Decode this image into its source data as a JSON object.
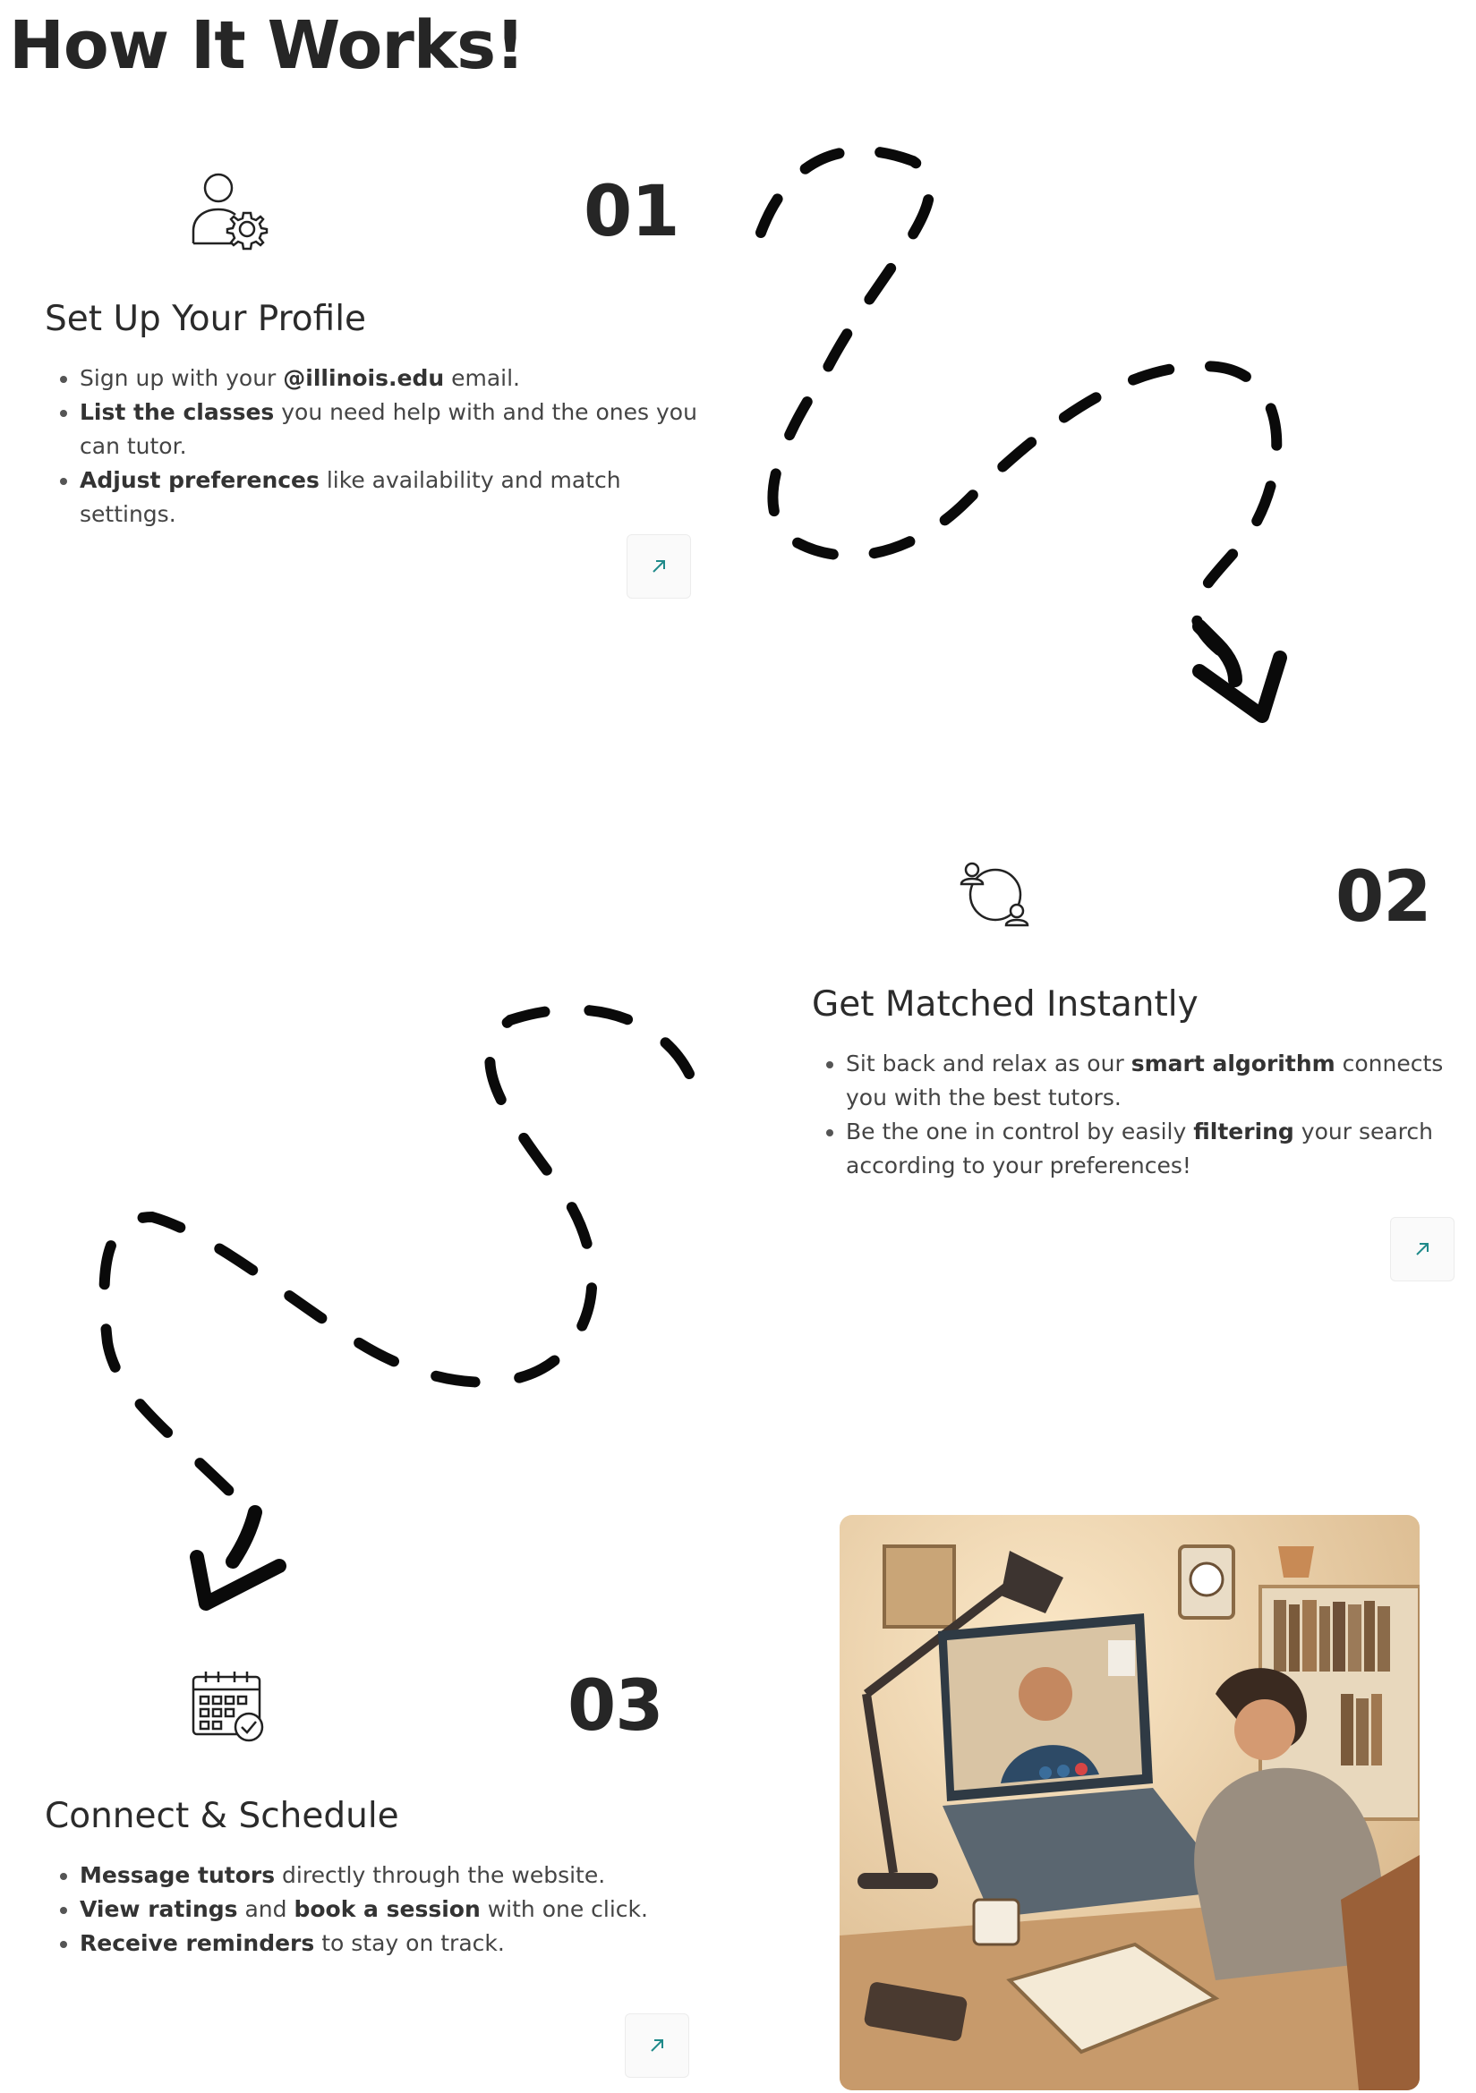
{
  "page_title": "How It Works!",
  "steps": [
    {
      "number": "01",
      "heading": "Set Up Your Profile",
      "icon": "user-gear-icon",
      "bullets": [
        [
          [
            "t",
            "Sign up with your "
          ],
          [
            "b",
            "@illinois.edu"
          ],
          [
            "t",
            " email."
          ]
        ],
        [
          [
            "b",
            "List the classes"
          ],
          [
            "t",
            " you need help with and the ones you can tutor."
          ]
        ],
        [
          [
            "b",
            "Adjust preferences"
          ],
          [
            "t",
            " like availability and match settings."
          ]
        ]
      ]
    },
    {
      "number": "02",
      "heading": "Get Matched Instantly",
      "icon": "people-match-icon",
      "bullets": [
        [
          [
            "t",
            "Sit back and relax as our "
          ],
          [
            "b",
            "smart algorithm"
          ],
          [
            "t",
            " connects you with the best tutors."
          ]
        ],
        [
          [
            "t",
            "Be the one in control by easily "
          ],
          [
            "b",
            "filtering"
          ],
          [
            "t",
            " your search according to your preferences!"
          ]
        ]
      ]
    },
    {
      "number": "03",
      "heading": "Connect & Schedule",
      "icon": "calendar-check-icon",
      "bullets": [
        [
          [
            "b",
            "Message tutors"
          ],
          [
            "t",
            " directly through the website."
          ]
        ],
        [
          [
            "b",
            "View ratings"
          ],
          [
            "t",
            " and "
          ],
          [
            "b",
            "book a session"
          ],
          [
            "t",
            " with one click."
          ]
        ],
        [
          [
            "b",
            "Receive reminders"
          ],
          [
            "t",
            " to stay on track."
          ]
        ]
      ]
    }
  ],
  "link_icon": "arrow-up-right-icon",
  "illustration": "student-video-call-illustration",
  "colors": {
    "accent": "#1f8a8a",
    "text": "#262626"
  }
}
